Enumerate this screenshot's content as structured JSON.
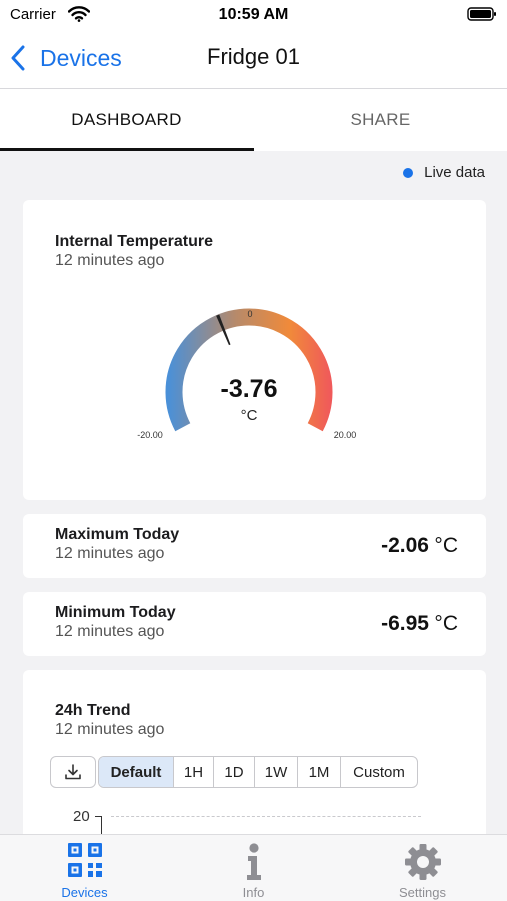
{
  "status_bar": {
    "carrier": "Carrier",
    "time": "10:59 AM"
  },
  "nav": {
    "back_label": "Devices",
    "title": "Fridge 01"
  },
  "tabs": [
    {
      "label": "DASHBOARD",
      "active": true
    },
    {
      "label": "SHARE",
      "active": false
    }
  ],
  "live_label": "Live data",
  "gauge": {
    "title": "Internal Temperature",
    "subtitle": "12 minutes ago",
    "value": "-3.76",
    "unit": "°C",
    "min_label": "-20.00",
    "max_label": "20.00",
    "mid_label": "0",
    "current": -3.76,
    "min": -20,
    "max": 20,
    "colors": {
      "cold": "#4a90d8",
      "mid": "#b78a6a",
      "warm": "#f08a3a",
      "hot": "#f05a5a"
    }
  },
  "max_today": {
    "title": "Maximum Today",
    "subtitle": "12 minutes ago",
    "value": "-2.06",
    "unit": "°C"
  },
  "min_today": {
    "title": "Minimum Today",
    "subtitle": "12 minutes ago",
    "value": "-6.95",
    "unit": "°C"
  },
  "trend": {
    "title": "24h Trend",
    "subtitle": "12 minutes ago",
    "download_icon": "download-icon",
    "ranges": [
      "Default",
      "1H",
      "1D",
      "1W",
      "1M",
      "Custom"
    ],
    "active_range": "Default",
    "y_tick": "20"
  },
  "bottom_tabs": [
    {
      "label": "Devices",
      "icon": "qr-code-icon",
      "active": true
    },
    {
      "label": "Info",
      "icon": "info-icon",
      "active": false
    },
    {
      "label": "Settings",
      "icon": "gear-icon",
      "active": false
    }
  ],
  "colors": {
    "accent": "#1a73e8",
    "inactive": "#8e8e93"
  }
}
